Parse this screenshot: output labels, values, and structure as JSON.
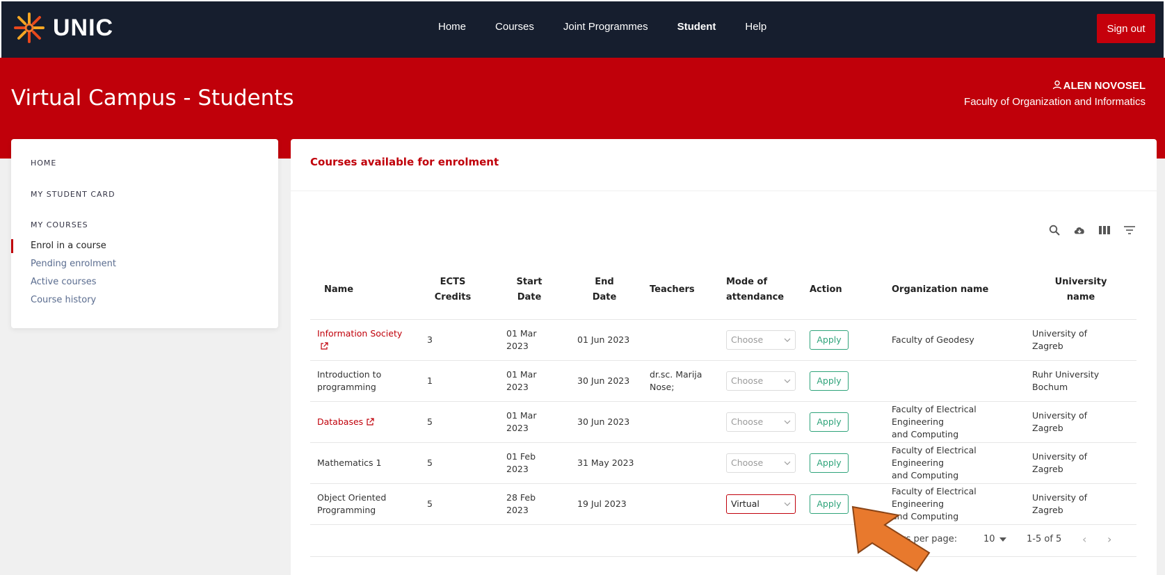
{
  "brand": {
    "logo_text": "UNIC",
    "accent": "#c0000a",
    "topbar_bg": "#161e2e",
    "apply_color": "#2ea37a"
  },
  "nav": {
    "items": [
      "Home",
      "Courses",
      "Joint Programmes",
      "Student",
      "Help"
    ],
    "active": "Student",
    "signout_label": "Sign out"
  },
  "banner": {
    "title": "Virtual Campus - Students",
    "user_name": "ALEN NOVOSEL",
    "user_org": "Faculty of Organization and Informatics"
  },
  "sidebar": {
    "home": "HOME",
    "student_card": "MY STUDENT CARD",
    "my_courses": "MY COURSES",
    "items": [
      "Enrol in a course",
      "Pending enrolment",
      "Active courses",
      "Course history"
    ],
    "current": "Enrol in a course"
  },
  "main": {
    "title": "Courses available for enrolment",
    "toolbar_icons": [
      "search-icon",
      "cloud-download-icon",
      "columns-icon",
      "filter-icon"
    ],
    "columns": {
      "name": "Name",
      "ects_1": "ECTS",
      "ects_2": "Credits",
      "start_1": "Start",
      "start_2": "Date",
      "end_1": "End",
      "end_2": "Date",
      "teachers": "Teachers",
      "mode_1": "Mode of",
      "mode_2": "attendance",
      "action": "Action",
      "org": "Organization name",
      "uni_1": "University",
      "uni_2": "name"
    },
    "rows": [
      {
        "name_1": "Information Society",
        "name_2": "",
        "link": true,
        "ects": "3",
        "start": "01 Mar 2023",
        "end": "01 Jun 2023",
        "teachers_1": "",
        "teachers_2": "",
        "mode": "Choose",
        "mode_selected": false,
        "action": "Apply",
        "org_1": "Faculty of Geodesy",
        "org_2": "",
        "uni_1": "University of",
        "uni_2": "Zagreb"
      },
      {
        "name_1": "Introduction to",
        "name_2": "programming",
        "link": false,
        "ects": "1",
        "start": "01 Mar 2023",
        "end": "30 Jun 2023",
        "teachers_1": "dr.sc. Marija",
        "teachers_2": "Nose;",
        "mode": "Choose",
        "mode_selected": false,
        "action": "Apply",
        "org_1": "",
        "org_2": "",
        "uni_1": "Ruhr University",
        "uni_2": "Bochum"
      },
      {
        "name_1": "Databases",
        "name_2": "",
        "link": true,
        "ects": "5",
        "start": "01 Mar 2023",
        "end": "30 Jun 2023",
        "teachers_1": "",
        "teachers_2": "",
        "mode": "Choose",
        "mode_selected": false,
        "action": "Apply",
        "org_1": "Faculty of Electrical Engineering",
        "org_2": "and Computing",
        "uni_1": "University of",
        "uni_2": "Zagreb"
      },
      {
        "name_1": "Mathematics 1",
        "name_2": "",
        "link": false,
        "ects": "5",
        "start": "01 Feb 2023",
        "end": "31 May 2023",
        "teachers_1": "",
        "teachers_2": "",
        "mode": "Choose",
        "mode_selected": false,
        "action": "Apply",
        "org_1": "Faculty of Electrical Engineering",
        "org_2": "and Computing",
        "uni_1": "University of",
        "uni_2": "Zagreb"
      },
      {
        "name_1": "Object Oriented",
        "name_2": "Programming",
        "link": false,
        "ects": "5",
        "start": "28 Feb 2023",
        "end": "19 Jul 2023",
        "teachers_1": "",
        "teachers_2": "",
        "mode": "Virtual",
        "mode_selected": true,
        "action": "Apply",
        "org_1": "Faculty of Electrical Engineering",
        "org_2": "and Computing",
        "uni_1": "University of",
        "uni_2": "Zagreb"
      }
    ],
    "pager": {
      "label": "ws per page:",
      "per_page": "10",
      "range": "1-5 of 5"
    }
  },
  "annotation": {
    "arrow_color": "#e8792d"
  }
}
